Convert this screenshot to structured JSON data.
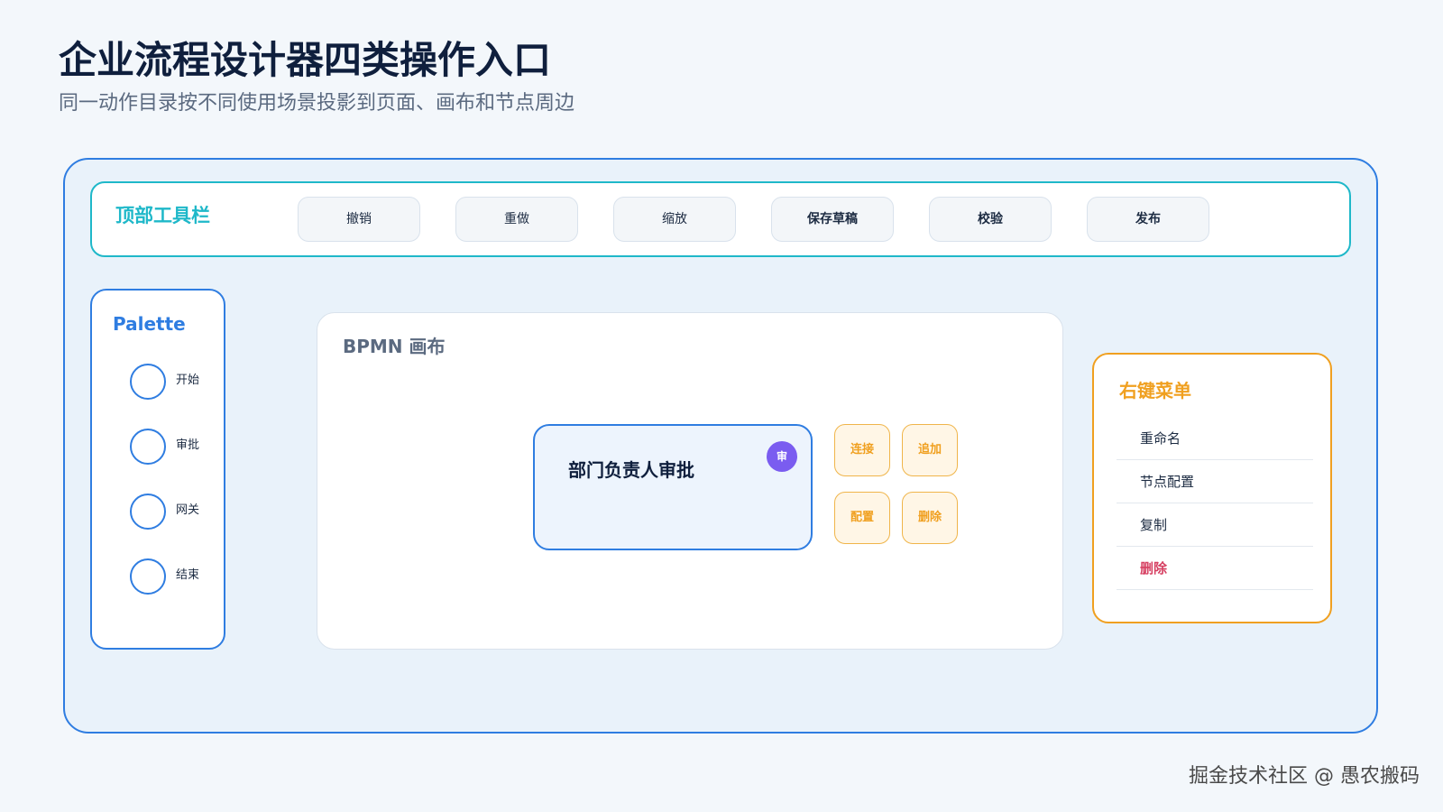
{
  "header": {
    "title": "企业流程设计器四类操作入口",
    "subtitle": "同一动作目录按不同使用场景投影到页面、画布和节点周边"
  },
  "toolbar": {
    "label": "顶部工具栏",
    "buttons": [
      {
        "label": "撤销"
      },
      {
        "label": "重做"
      },
      {
        "label": "缩放"
      },
      {
        "label": "保存草稿"
      },
      {
        "label": "校验"
      },
      {
        "label": "发布"
      }
    ]
  },
  "palette": {
    "title": "Palette",
    "items": [
      {
        "label": "开始"
      },
      {
        "label": "审批"
      },
      {
        "label": "网关"
      },
      {
        "label": "结束"
      }
    ]
  },
  "canvas": {
    "title": "BPMN 画布",
    "node": {
      "label": "部门负责人审批",
      "badge": "审"
    },
    "context_pad": [
      {
        "label": "连接"
      },
      {
        "label": "追加"
      },
      {
        "label": "配置"
      },
      {
        "label": "删除"
      }
    ]
  },
  "context_menu": {
    "title": "右键菜单",
    "items": [
      {
        "label": "重命名"
      },
      {
        "label": "节点配置"
      },
      {
        "label": "复制"
      },
      {
        "label": "删除"
      }
    ]
  },
  "colors": {
    "primary": "#2f7de1",
    "toolbar_accent": "#1fb8c9",
    "menu_accent": "#f0a020",
    "danger": "#d64062",
    "badge": "#7a5cf0"
  },
  "watermark": "掘金技术社区 @ 愚农搬码"
}
